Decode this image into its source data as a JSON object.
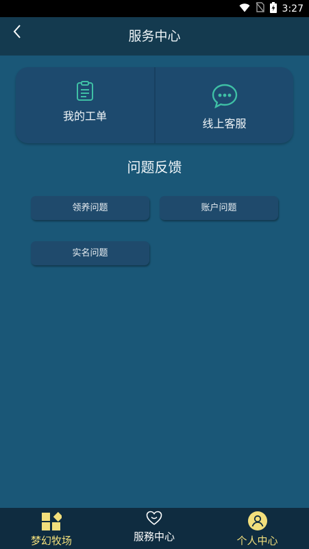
{
  "status_bar": {
    "time": "3:27",
    "icons": [
      "wifi-icon",
      "no-sim-icon",
      "battery-charging-icon"
    ]
  },
  "app_bar": {
    "title": "服务中心",
    "back_icon": "chevron-left-icon"
  },
  "top_card": {
    "left": {
      "label": "我的工单",
      "icon": "clipboard-icon"
    },
    "right": {
      "label": "线上客服",
      "icon": "chat-bubble-icon"
    }
  },
  "feedback": {
    "title": "问题反馈",
    "buttons": [
      {
        "label": "领养问题"
      },
      {
        "label": "账户问题"
      },
      {
        "label": "实名问题"
      }
    ]
  },
  "bottom_nav": {
    "items": [
      {
        "label": "梦幻牧场",
        "icon": "grid-diamond-icon",
        "color": "#f2df7c"
      },
      {
        "label": "服務中心",
        "icon": "heart-icon",
        "color": "#ffffff"
      },
      {
        "label": "个人中心",
        "icon": "user-circle-icon",
        "color": "#f2df7c"
      }
    ]
  },
  "colors": {
    "background": "#1a5777",
    "app_bar": "#143a4f",
    "card": "#1d4a6e",
    "accent_teal": "#3fc0a5",
    "nav_bar": "#0f2c40",
    "nav_active_yellow": "#f2df7c"
  }
}
